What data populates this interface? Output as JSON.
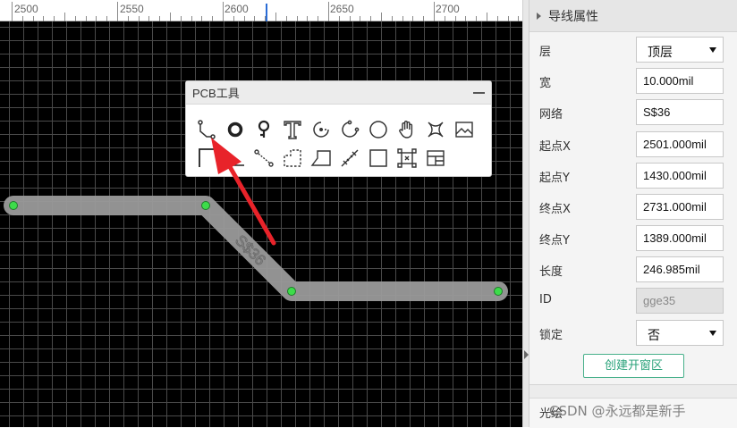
{
  "ruler": {
    "labels": [
      "2500",
      "2550",
      "2600",
      "2650",
      "2700"
    ]
  },
  "trace": {
    "net_label": "S$36",
    "color": "#9a9a9a",
    "pad_color": "#3ddc4a"
  },
  "pcb_tools": {
    "title": "PCB工具",
    "tools_row1": [
      "wire",
      "pad",
      "via",
      "text",
      "arc-center",
      "arc-3pt",
      "circle",
      "pan-hand",
      "solid-region",
      "image"
    ],
    "tools_row2": [
      "dimension",
      "line",
      "connect",
      "region",
      "polygon",
      "measure",
      "rectangle",
      "copper-area",
      "board-outline"
    ]
  },
  "annotation": {
    "color": "#e8232a"
  },
  "properties": {
    "title": "导线属性",
    "rows": [
      {
        "label": "层",
        "value": "顶层",
        "type": "select"
      },
      {
        "label": "宽",
        "value": "10.000mil",
        "type": "input"
      },
      {
        "label": "网络",
        "value": "S$36",
        "type": "input"
      },
      {
        "label": "起点X",
        "value": "2501.000mil",
        "type": "input"
      },
      {
        "label": "起点Y",
        "value": "1430.000mil",
        "type": "input"
      },
      {
        "label": "终点X",
        "value": "2731.000mil",
        "type": "input"
      },
      {
        "label": "终点Y",
        "value": "1389.000mil",
        "type": "input"
      },
      {
        "label": "长度",
        "value": "246.985mil",
        "type": "input"
      },
      {
        "label": "ID",
        "value": "gge35",
        "type": "disabled"
      },
      {
        "label": "锁定",
        "value": "否",
        "type": "select"
      }
    ],
    "create_window_label": "创建开窗区",
    "optical_label": "光绘",
    "accent": "#2aa27a"
  },
  "watermark": "CSDN @永远都是新手"
}
